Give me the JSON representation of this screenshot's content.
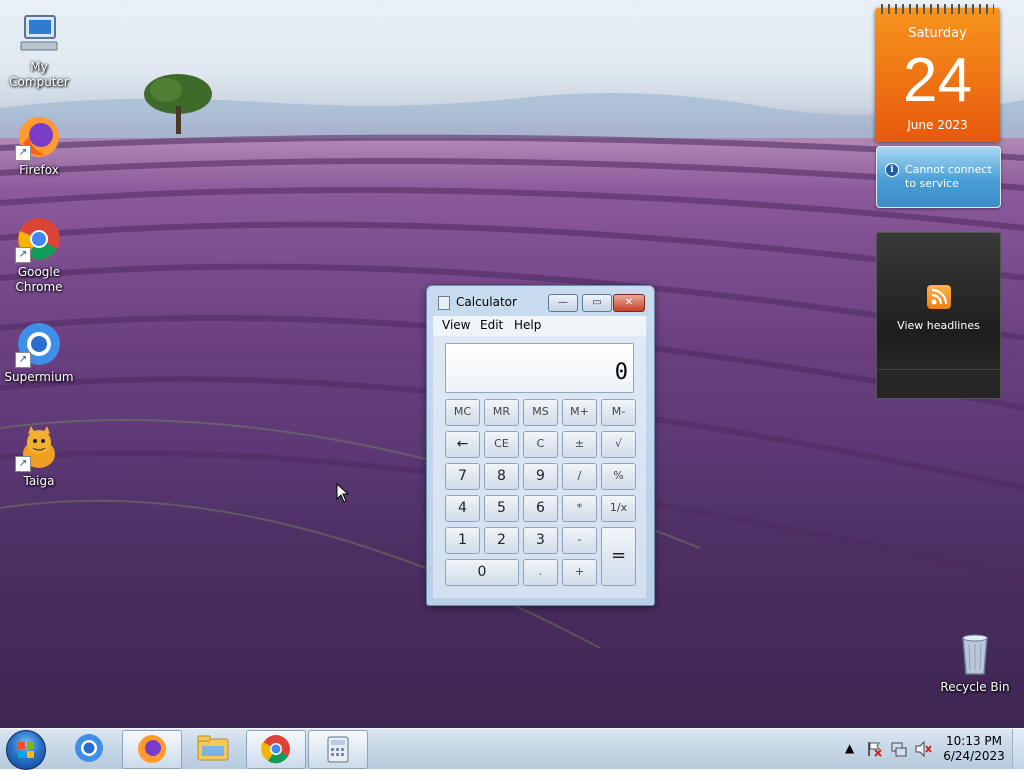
{
  "desktop_icons": [
    {
      "label": "My Computer",
      "icon": "computer-icon"
    },
    {
      "label": "Firefox",
      "icon": "firefox-icon"
    },
    {
      "label": "Google Chrome",
      "icon": "chrome-icon"
    },
    {
      "label": "Supermium",
      "icon": "supermium-icon"
    },
    {
      "label": "Taiga",
      "icon": "taiga-icon"
    },
    {
      "label": "Recycle Bin",
      "icon": "recycle-bin-icon"
    }
  ],
  "gadgets": {
    "calendar": {
      "day": "Saturday",
      "date": "24",
      "month": "June 2023"
    },
    "weather": {
      "message": "Cannot connect to service"
    },
    "feed": {
      "label": "View headlines"
    }
  },
  "calculator": {
    "title": "Calculator",
    "menu": [
      "View",
      "Edit",
      "Help"
    ],
    "display": "0",
    "window_buttons": {
      "minimize": "—",
      "maximize": "▭",
      "close": "✕"
    },
    "rows": [
      [
        "MC",
        "MR",
        "MS",
        "M+",
        "M-"
      ],
      [
        "←",
        "CE",
        "C",
        "±",
        "√"
      ],
      [
        "7",
        "8",
        "9",
        "/",
        "%"
      ],
      [
        "4",
        "5",
        "6",
        "*",
        "1/x"
      ],
      [
        "1",
        "2",
        "3",
        "-",
        "="
      ],
      [
        "0",
        ".",
        "+"
      ]
    ]
  },
  "taskbar": {
    "pinned": [
      "supermium-icon",
      "firefox-icon",
      "file-explorer-icon",
      "chrome-icon",
      "calculator-icon"
    ],
    "clock_time": "10:13 PM",
    "clock_date": "6/24/2023",
    "tray_icons": [
      "show-hidden-icons-arrow",
      "action-center-flag-icon",
      "network-icon",
      "volume-muted-icon"
    ],
    "tray_arrow": "▲"
  },
  "colors": {
    "calendar_orange": "#e8590c",
    "weather_blue": "#4a9fd6",
    "rss_orange": "#f07e10"
  }
}
